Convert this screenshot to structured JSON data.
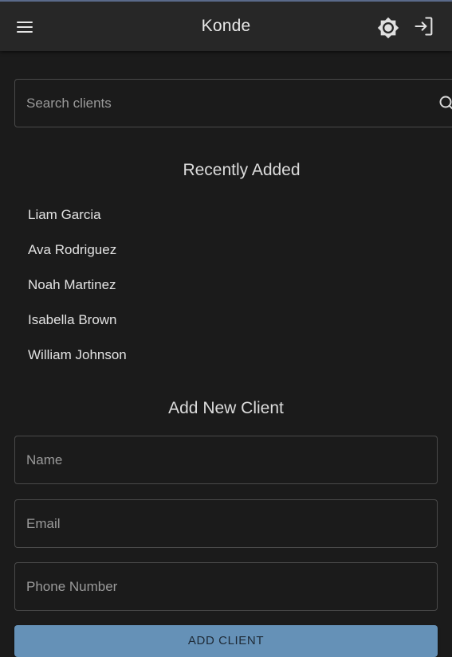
{
  "header": {
    "title": "Konde",
    "menu_icon": "hamburger-menu-icon",
    "theme_icon": "brightness-icon",
    "login_icon": "login-icon"
  },
  "search": {
    "placeholder": "Search clients",
    "icon": "search-icon"
  },
  "recent": {
    "title": "Recently Added",
    "clients": [
      "Liam Garcia",
      "Ava Rodriguez",
      "Noah Martinez",
      "Isabella Brown",
      "William Johnson"
    ]
  },
  "add_client": {
    "title": "Add New Client",
    "name_placeholder": "Name",
    "email_placeholder": "Email",
    "phone_placeholder": "Phone Number",
    "submit_label": "ADD CLIENT"
  },
  "colors": {
    "background": "#1b1b1b",
    "topbar": "#272727",
    "accent": "#6591b7"
  }
}
